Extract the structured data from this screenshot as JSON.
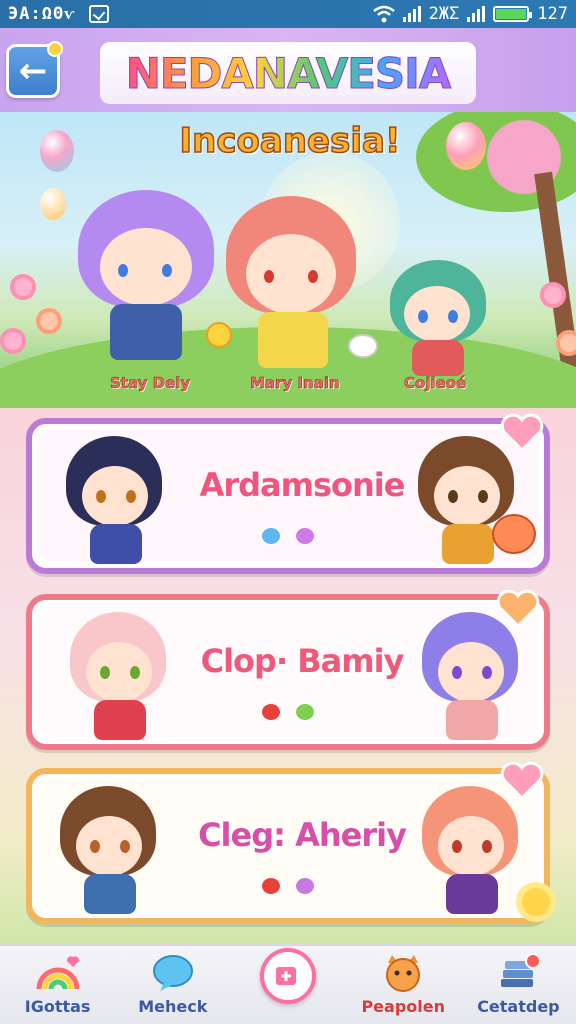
{
  "status_bar": {
    "time": "ЭА:ΩΘѵ",
    "signal_text": "2ЖΣ",
    "battery_text": "127"
  },
  "header": {
    "title": "NEDANAVESIA",
    "back_label": "←"
  },
  "hero": {
    "subtitle": "Incoanesia!",
    "characters": [
      {
        "name": "Stay Deiy"
      },
      {
        "name": "Mary Inain"
      },
      {
        "name": "Cojieoé"
      }
    ]
  },
  "cards": [
    {
      "title": "Ardamsonie",
      "color": "#b97ad8",
      "title_color": "#f2547e",
      "dots": [
        "#5eb7f2",
        "#d07ae8"
      ]
    },
    {
      "title": "Clop· Bamiy",
      "color": "#ef7a8a",
      "title_color": "#f05a7a",
      "dots": [
        "#e8413a",
        "#7fd04e"
      ]
    },
    {
      "title": "Cleg: Aheriy",
      "color": "#f5b55a",
      "title_color": "#d74fa8",
      "dots": [
        "#e8413a",
        "#c879e0"
      ]
    }
  ],
  "bottom_nav": [
    {
      "label": "IGottas",
      "icon": "rainbow-icon"
    },
    {
      "label": "Meheck",
      "icon": "chat-bubble-icon"
    },
    {
      "label": "",
      "icon": "add-image-icon"
    },
    {
      "label": "Peapolen",
      "icon": "cat-face-icon"
    },
    {
      "label": "Cetatdep",
      "icon": "books-icon"
    }
  ]
}
